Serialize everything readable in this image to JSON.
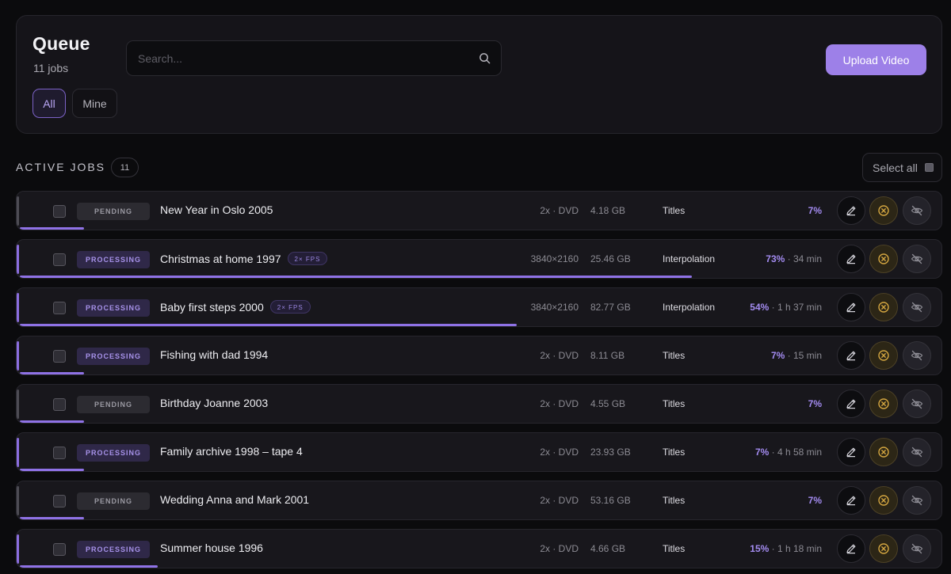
{
  "header": {
    "title": "Queue",
    "job_count": "11 jobs",
    "search_placeholder": "Search...",
    "filters": {
      "all": "All",
      "mine": "Mine"
    },
    "upload_label": "Upload Video"
  },
  "section": {
    "title": "ACTIVE JOBS",
    "count": "11",
    "select_all_label": "Select all"
  },
  "colors": {
    "accent": "#9d80e8",
    "background": "#0b0b0d",
    "card": "#18171c",
    "cancel": "#d4a640"
  },
  "jobs": [
    {
      "status": "PENDING",
      "title": "New Year in Oslo 2005",
      "fps": "",
      "resolution": "2x · DVD",
      "size": "4.18 GB",
      "mode": "Titles",
      "progress_label": "7%",
      "eta": "",
      "progress": 0.07
    },
    {
      "status": "PROCESSING",
      "title": "Christmas at home 1997",
      "fps": "2× FPS",
      "resolution": "3840×2160",
      "size": "25.46 GB",
      "mode": "Interpolation",
      "progress_label": "73%",
      "eta": " · 34 min",
      "progress": 0.73
    },
    {
      "status": "PROCESSING",
      "title": "Baby first steps 2000",
      "fps": "2× FPS",
      "resolution": "3840×2160",
      "size": "82.77 GB",
      "mode": "Interpolation",
      "progress_label": "54%",
      "eta": " · 1 h 37 min",
      "progress": 0.54
    },
    {
      "status": "PROCESSING",
      "title": "Fishing with dad 1994",
      "fps": "",
      "resolution": "2x · DVD",
      "size": "8.11 GB",
      "mode": "Titles",
      "progress_label": "7%",
      "eta": " · 15 min",
      "progress": 0.07
    },
    {
      "status": "PENDING",
      "title": "Birthday Joanne 2003",
      "fps": "",
      "resolution": "2x · DVD",
      "size": "4.55 GB",
      "mode": "Titles",
      "progress_label": "7%",
      "eta": "",
      "progress": 0.07
    },
    {
      "status": "PROCESSING",
      "title": "Family archive 1998 – tape 4",
      "fps": "",
      "resolution": "2x · DVD",
      "size": "23.93 GB",
      "mode": "Titles",
      "progress_label": "7%",
      "eta": " · 4 h 58 min",
      "progress": 0.07
    },
    {
      "status": "PENDING",
      "title": "Wedding Anna and Mark 2001",
      "fps": "",
      "resolution": "2x · DVD",
      "size": "53.16 GB",
      "mode": "Titles",
      "progress_label": "7%",
      "eta": "",
      "progress": 0.07
    },
    {
      "status": "PROCESSING",
      "title": "Summer house 1996",
      "fps": "",
      "resolution": "2x · DVD",
      "size": "4.66 GB",
      "mode": "Titles",
      "progress_label": "15%",
      "eta": " · 1 h 18 min",
      "progress": 0.15
    }
  ]
}
